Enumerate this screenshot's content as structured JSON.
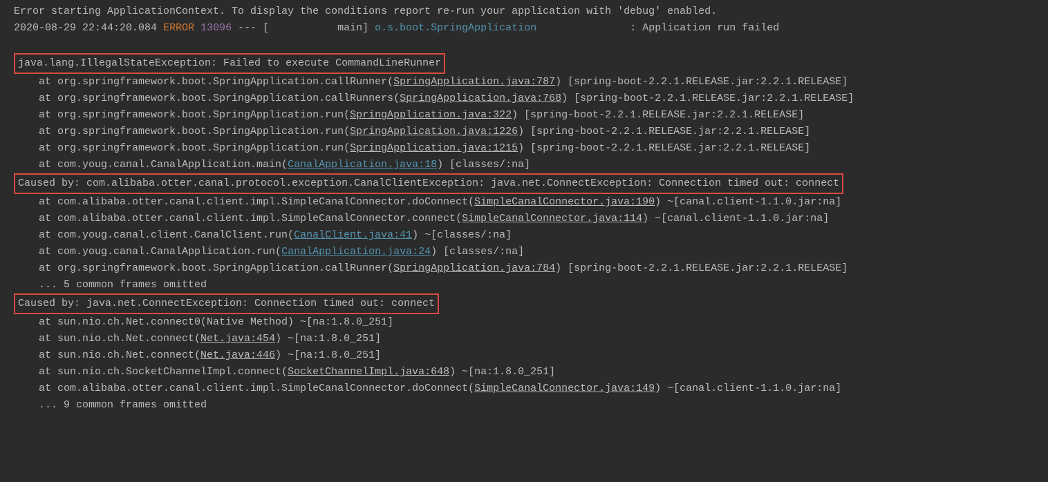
{
  "header": {
    "line1": "Error starting ApplicationContext. To display the conditions report re-run your application with 'debug' enabled.",
    "timestamp": "2020-08-29 22:44:20.084",
    "level": "ERROR",
    "pid": "13096",
    "separator": " --- [           main] ",
    "logger": "o.s.boot.SpringApplication",
    "spacer": "               ",
    "message": ": Application run failed"
  },
  "exception1": {
    "title": "java.lang.IllegalStateException: Failed to execute CommandLineRunner",
    "frames": [
      {
        "prefix": "at org.springframework.boot.SpringApplication.callRunner(",
        "link": "SpringApplication.java:787",
        "linkType": "grey",
        "suffix": ") [spring-boot-2.2.1.RELEASE.jar:2.2.1.RELEASE]"
      },
      {
        "prefix": "at org.springframework.boot.SpringApplication.callRunners(",
        "link": "SpringApplication.java:768",
        "linkType": "grey",
        "suffix": ") [spring-boot-2.2.1.RELEASE.jar:2.2.1.RELEASE]"
      },
      {
        "prefix": "at org.springframework.boot.SpringApplication.run(",
        "link": "SpringApplication.java:322",
        "linkType": "grey",
        "suffix": ") [spring-boot-2.2.1.RELEASE.jar:2.2.1.RELEASE]"
      },
      {
        "prefix": "at org.springframework.boot.SpringApplication.run(",
        "link": "SpringApplication.java:1226",
        "linkType": "grey",
        "suffix": ") [spring-boot-2.2.1.RELEASE.jar:2.2.1.RELEASE]"
      },
      {
        "prefix": "at org.springframework.boot.SpringApplication.run(",
        "link": "SpringApplication.java:1215",
        "linkType": "grey",
        "suffix": ") [spring-boot-2.2.1.RELEASE.jar:2.2.1.RELEASE]"
      },
      {
        "prefix": "at com.youg.canal.CanalApplication.main(",
        "link": "CanalApplication.java:18",
        "linkType": "blue",
        "suffix": ") [classes/:na]"
      }
    ]
  },
  "exception2": {
    "title": "Caused by: com.alibaba.otter.canal.protocol.exception.CanalClientException: java.net.ConnectException: Connection timed out: connect",
    "frames": [
      {
        "prefix": "at com.alibaba.otter.canal.client.impl.SimpleCanalConnector.doConnect(",
        "link": "SimpleCanalConnector.java:190",
        "linkType": "grey",
        "suffix": ") ~[canal.client-1.1.0.jar:na]"
      },
      {
        "prefix": "at com.alibaba.otter.canal.client.impl.SimpleCanalConnector.connect(",
        "link": "SimpleCanalConnector.java:114",
        "linkType": "grey",
        "suffix": ") ~[canal.client-1.1.0.jar:na]"
      },
      {
        "prefix": "at com.youg.canal.client.CanalClient.run(",
        "link": "CanalClient.java:41",
        "linkType": "blue",
        "suffix": ") ~[classes/:na]"
      },
      {
        "prefix": "at com.youg.canal.CanalApplication.run(",
        "link": "CanalApplication.java:24",
        "linkType": "blue",
        "suffix": ") [classes/:na]"
      },
      {
        "prefix": "at org.springframework.boot.SpringApplication.callRunner(",
        "link": "SpringApplication.java:784",
        "linkType": "grey",
        "suffix": ") [spring-boot-2.2.1.RELEASE.jar:2.2.1.RELEASE]"
      }
    ],
    "omitted": "... 5 common frames omitted"
  },
  "exception3": {
    "title": "Caused by: java.net.ConnectException: Connection timed out: connect",
    "frames": [
      {
        "prefix": "at sun.nio.ch.Net.connect0(Native Method) ~[na:1.8.0_251]",
        "link": "",
        "linkType": "none",
        "suffix": ""
      },
      {
        "prefix": "at sun.nio.ch.Net.connect(",
        "link": "Net.java:454",
        "linkType": "grey",
        "suffix": ") ~[na:1.8.0_251]"
      },
      {
        "prefix": "at sun.nio.ch.Net.connect(",
        "link": "Net.java:446",
        "linkType": "grey",
        "suffix": ") ~[na:1.8.0_251]"
      },
      {
        "prefix": "at sun.nio.ch.SocketChannelImpl.connect(",
        "link": "SocketChannelImpl.java:648",
        "linkType": "grey",
        "suffix": ") ~[na:1.8.0_251]"
      },
      {
        "prefix": "at com.alibaba.otter.canal.client.impl.SimpleCanalConnector.doConnect(",
        "link": "SimpleCanalConnector.java:149",
        "linkType": "grey",
        "suffix": ") ~[canal.client-1.1.0.jar:na]"
      }
    ],
    "omitted": "... 9 common frames omitted"
  }
}
